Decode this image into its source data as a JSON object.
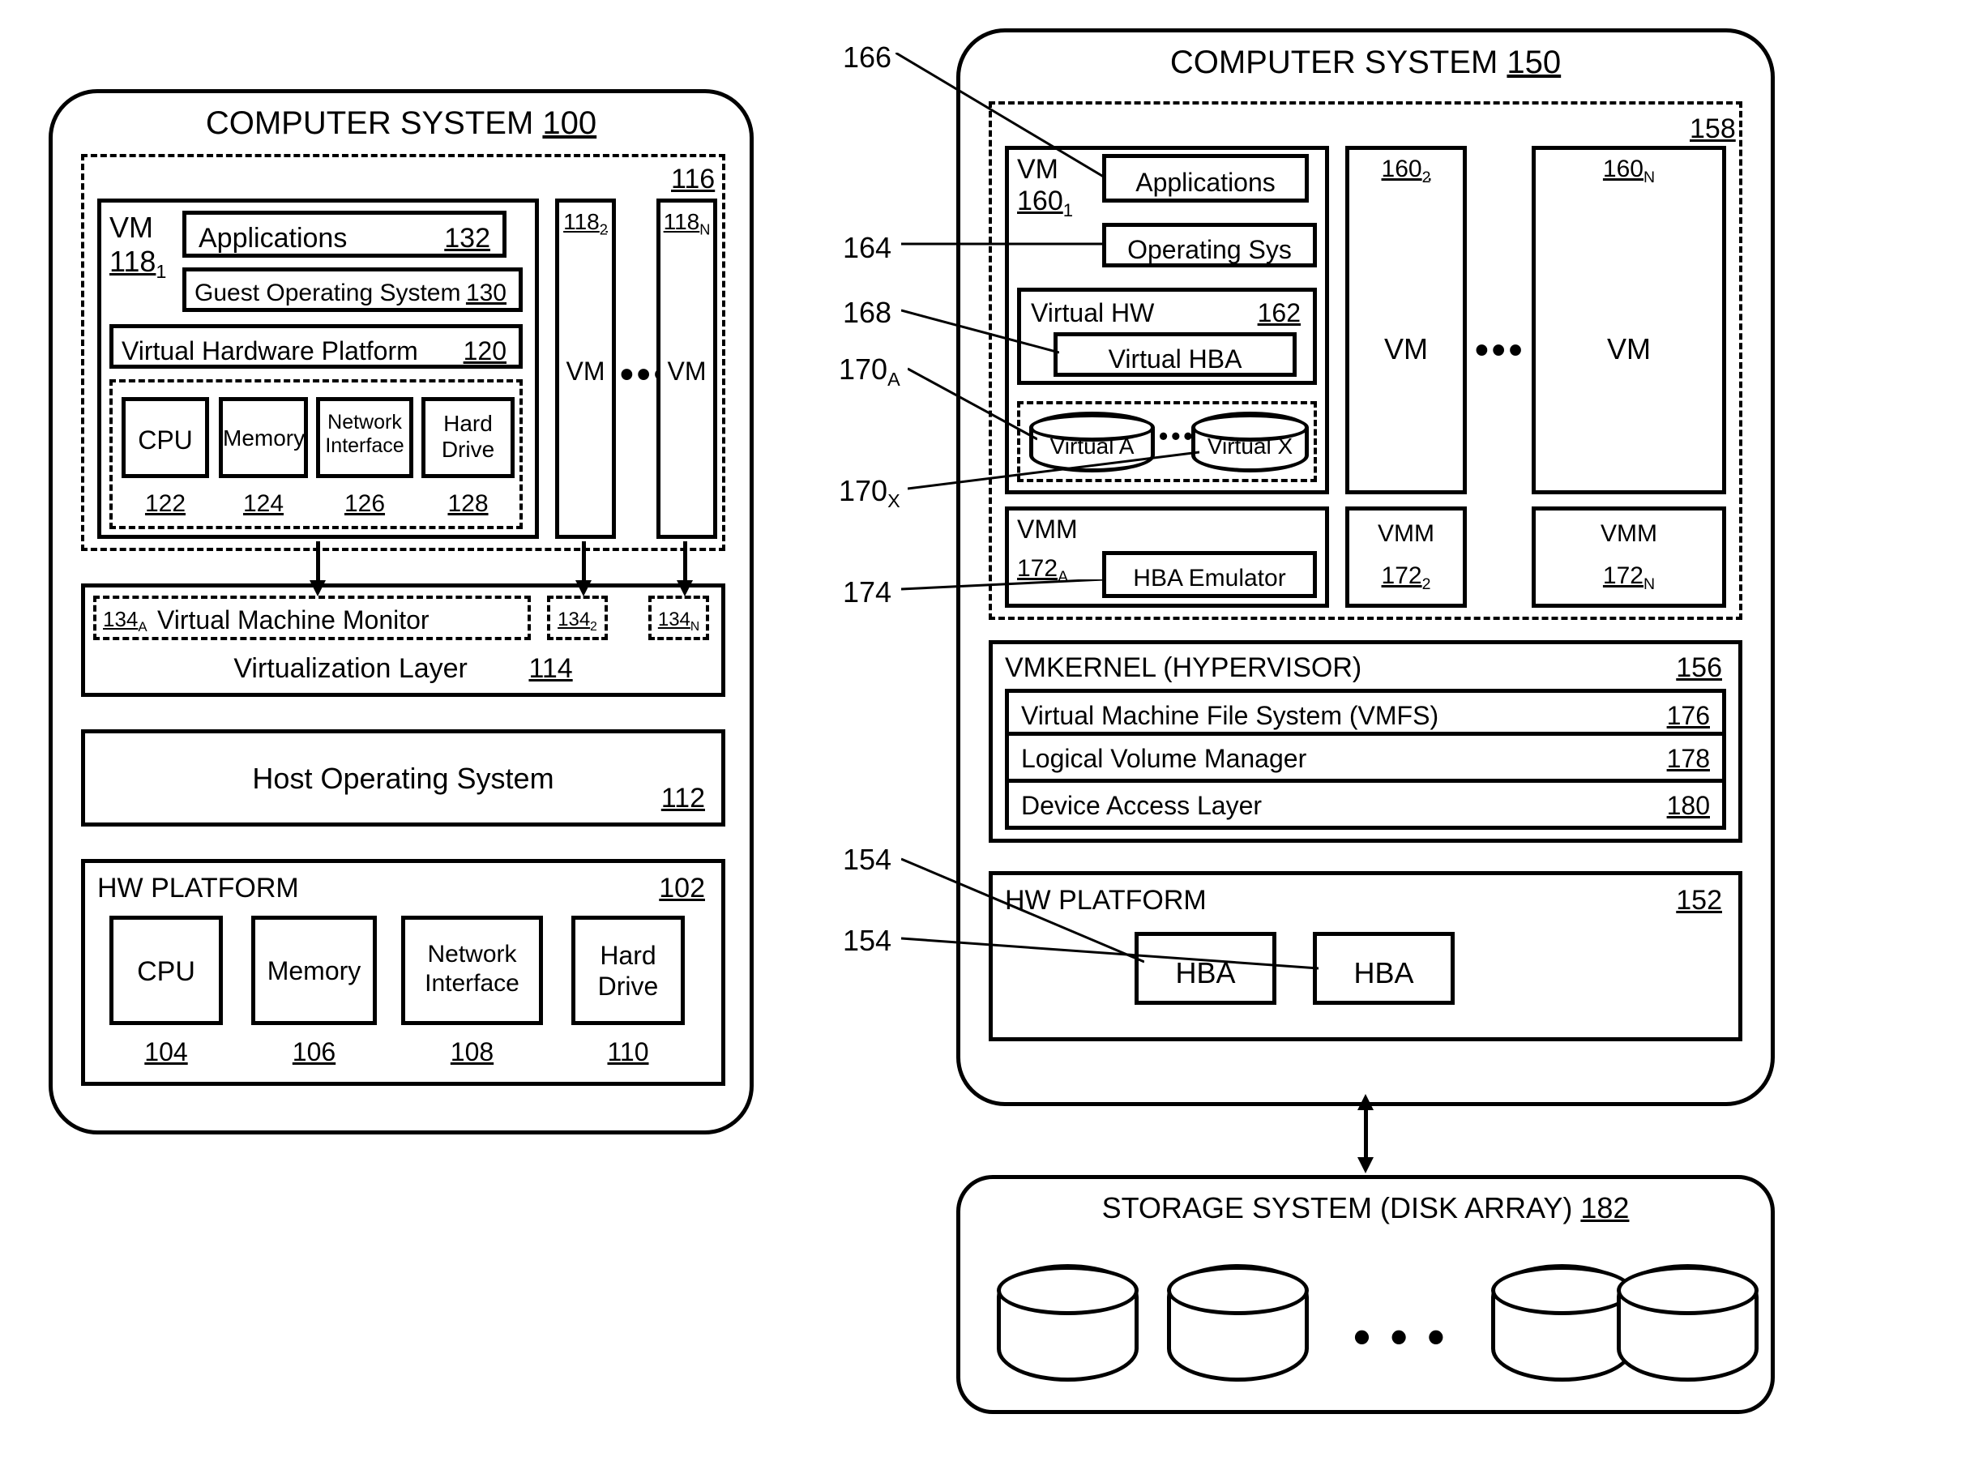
{
  "left": {
    "title": "COMPUTER SYSTEM",
    "title_ref": "100",
    "vm_group_ref": "116",
    "vm1_label": "VM",
    "vm1_ref": "118",
    "vm1_sub": "1",
    "apps": "Applications",
    "apps_ref": "132",
    "guest_os": "Guest Operating System",
    "guest_os_ref": "130",
    "vhp": "Virtual Hardware Platform",
    "vhp_ref": "120",
    "cpu": "CPU",
    "cpu_ref": "122",
    "memory": "Memory",
    "memory_ref": "124",
    "netif": "Network Interface",
    "netif_ref": "126",
    "hdd": "Hard Drive",
    "hdd_ref": "128",
    "vm2_ref": "118",
    "vm2_sub": "2",
    "vm2_label": "VM",
    "vmN_ref": "118",
    "vmN_sub": "N",
    "vmN_label": "VM",
    "vmm_refA": "134",
    "vmm_subA": "A",
    "vmm_label": "Virtual Machine Monitor",
    "vmm_ref2": "134",
    "vmm_sub2": "2",
    "vmm_refN": "134",
    "vmm_subN": "N",
    "virt_layer": "Virtualization Layer",
    "virt_layer_ref": "114",
    "host_os": "Host Operating System",
    "host_os_ref": "112",
    "hw_platform": "HW PLATFORM",
    "hw_platform_ref": "102",
    "hw_cpu": "CPU",
    "hw_cpu_ref": "104",
    "hw_mem": "Memory",
    "hw_mem_ref": "106",
    "hw_netif": "Network Interface",
    "hw_netif_ref": "108",
    "hw_hdd": "Hard Drive",
    "hw_hdd_ref": "110"
  },
  "right": {
    "title": "COMPUTER SYSTEM",
    "title_ref": "150",
    "group_ref": "158",
    "vm1_label": "VM",
    "vm1_ref": "160",
    "vm1_sub": "1",
    "apps": "Applications",
    "os": "Operating Sys",
    "vhw": "Virtual HW",
    "vhw_ref": "162",
    "vhba": "Virtual HBA",
    "va": "Virtual A",
    "vx": "Virtual X",
    "vmm": "VMM",
    "vmm_refA": "172",
    "vmm_subA": "A",
    "hba_emu": "HBA Emulator",
    "vm2_ref": "160",
    "vm2_sub": "2",
    "vm2_label": "VM",
    "vmN_ref": "160",
    "vmN_sub": "N",
    "vmN_label": "VM",
    "vmm2_label": "VMM",
    "vmm2_ref": "172",
    "vmm2_sub": "2",
    "vmmN_label": "VMM",
    "vmmN_ref": "172",
    "vmmN_sub": "N",
    "vmkernel": "VMKERNEL (HYPERVISOR)",
    "vmkernel_ref": "156",
    "vmfs": "Virtual Machine File System (VMFS)",
    "vmfs_ref": "176",
    "lvm": "Logical Volume Manager",
    "lvm_ref": "178",
    "dal": "Device Access Layer",
    "dal_ref": "180",
    "hw_platform": "HW PLATFORM",
    "hw_platform_ref": "152",
    "hba": "HBA",
    "storage": "STORAGE SYSTEM (DISK ARRAY)",
    "storage_ref": "182"
  },
  "callouts": {
    "c166": "166",
    "c164": "164",
    "c168": "168",
    "c170A": "170",
    "c170A_sub": "A",
    "c170X": "170",
    "c170X_sub": "X",
    "c174": "174",
    "c154a": "154",
    "c154b": "154"
  }
}
